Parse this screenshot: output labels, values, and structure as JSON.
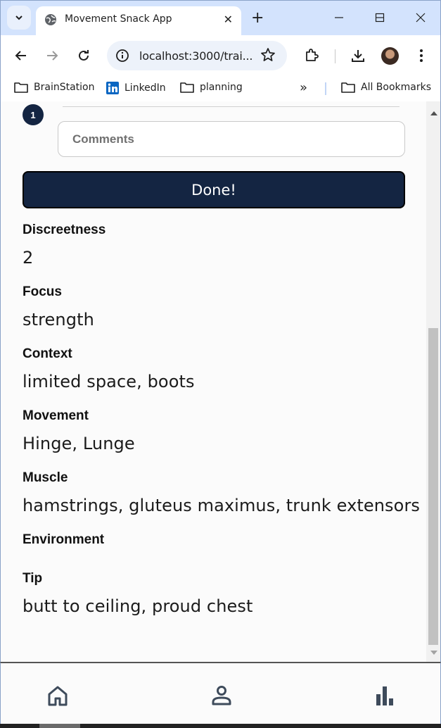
{
  "browser": {
    "tab_title": "Movement Snack App",
    "tab_favicon": "globe-icon",
    "url": "localhost:3000/trai...",
    "bookmarks": [
      {
        "label": "BrainStation",
        "icon": "folder-icon"
      },
      {
        "label": "LinkedIn",
        "icon": "linkedin-icon"
      },
      {
        "label": "planning",
        "icon": "folder-icon"
      }
    ],
    "all_bookmarks_label": "All Bookmarks"
  },
  "exercise": {
    "step_number": "1",
    "comments_placeholder": "Comments",
    "done_label": "Done!"
  },
  "details": {
    "discreetness": {
      "label": "Discreetness",
      "value": "2"
    },
    "focus": {
      "label": "Focus",
      "value": "strength"
    },
    "context": {
      "label": "Context",
      "value": "limited space, boots"
    },
    "movement": {
      "label": "Movement",
      "value": "Hinge, Lunge"
    },
    "muscle": {
      "label": "Muscle",
      "value": "hamstrings, gluteus maximus, trunk extensors"
    },
    "environment": {
      "label": "Environment",
      "value": ""
    },
    "tip": {
      "label": "Tip",
      "value": "butt to ceiling, proud chest"
    }
  },
  "nav": {
    "items": [
      {
        "icon": "home-icon"
      },
      {
        "icon": "profile-icon"
      },
      {
        "icon": "stats-icon"
      }
    ]
  },
  "colors": {
    "primary": "#142542",
    "chrome_tabstrip": "#d3e3fd",
    "page_background": "#fbfbfb"
  }
}
